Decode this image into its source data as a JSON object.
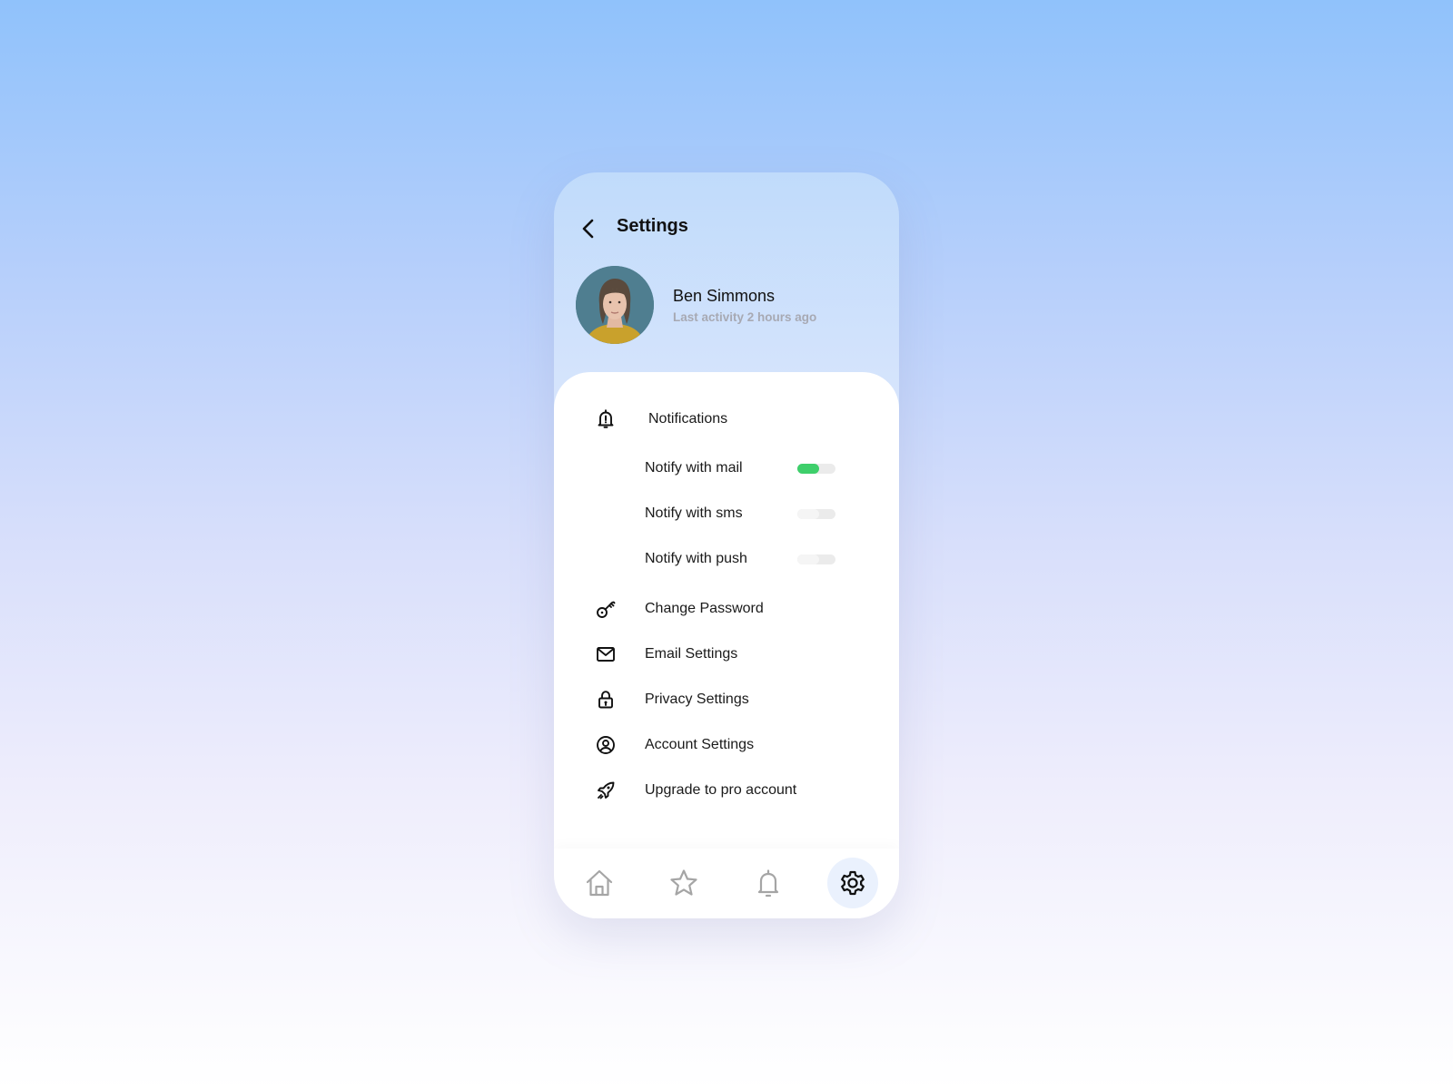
{
  "header": {
    "title": "Settings",
    "back_icon": "chevron-left-icon"
  },
  "profile": {
    "name": "Ben Simmons",
    "activity": "Last activity 2 hours ago",
    "avatar": "user-photo"
  },
  "menu": {
    "notifications": {
      "label": "Notifications",
      "icon": "bell-alert-icon",
      "options": [
        {
          "label": "Notify with mail",
          "enabled": true
        },
        {
          "label": "Notify with sms",
          "enabled": false
        },
        {
          "label": "Notify with push",
          "enabled": false
        }
      ]
    },
    "items": [
      {
        "label": "Change Password",
        "icon": "key-icon"
      },
      {
        "label": "Email Settings",
        "icon": "mail-icon"
      },
      {
        "label": "Privacy Settings",
        "icon": "lock-icon"
      },
      {
        "label": "Account Settings",
        "icon": "user-circle-icon"
      },
      {
        "label": "Upgrade to pro account",
        "icon": "rocket-icon"
      }
    ]
  },
  "bottom_nav": {
    "items": [
      {
        "name": "home",
        "icon": "home-icon",
        "active": false
      },
      {
        "name": "favorites",
        "icon": "star-icon",
        "active": false
      },
      {
        "name": "notifications",
        "icon": "bell-icon",
        "active": false
      },
      {
        "name": "settings",
        "icon": "gear-icon",
        "active": true
      }
    ]
  },
  "colors": {
    "toggle_on": "#3ecf6b",
    "toggle_track": "#ebebeb",
    "active_nav_bg": "#eaf1fd",
    "muted_text": "#a7a9b3"
  }
}
